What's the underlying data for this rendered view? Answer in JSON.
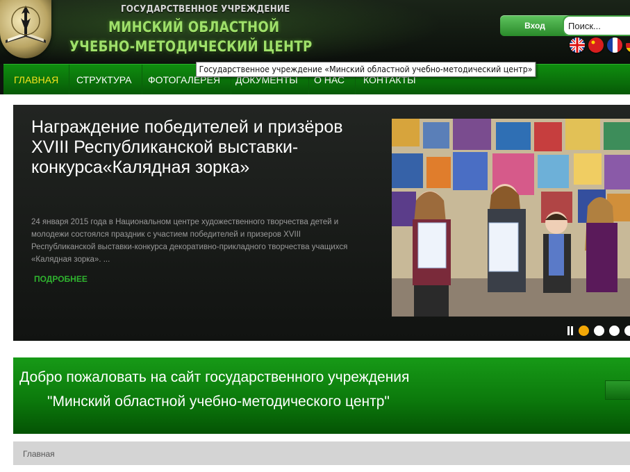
{
  "header": {
    "org_type": "ГОСУДАРСТВЕННОЕ УЧРЕЖДЕНИЕ",
    "org_name_line1": "МИНСКИЙ ОБЛАСТНОЙ",
    "org_name_line2": "УЧЕБНО-МЕТОДИЧЕСКИЙ ЦЕНТР",
    "login_label": "Вход",
    "search_placeholder": "Поиск...",
    "languages": [
      "english-flag-icon",
      "chinese-flag-icon",
      "french-flag-icon",
      "german-flag-icon"
    ]
  },
  "nav": {
    "items": [
      "ГЛАВНАЯ",
      "СТРУКТУРА",
      "ФОТОГАЛЕРЕЯ",
      "ДОКУМЕНТЫ",
      "О НАС",
      "КОНТАКТЫ"
    ],
    "active_index": 0
  },
  "tooltip": "Государственное учреждение «Минский областной учебно-методический центр»",
  "slider": {
    "title": "Награждение победителей и призёров XVIII Республиканской выставки-конкурса«Калядная зорка»",
    "text": "24 января 2015 года в Национальном центре художественного творчества детей и молодежи состоялся праздник с участием победителей и призеров XVIII Республиканской выставки-конкурса декоративно-прикладного творчества учащихся «Калядная зорка». ...",
    "more_label": "ПОДРОБНЕЕ",
    "slide_count": 4,
    "active_slide": 1
  },
  "welcome": {
    "line1": "Добро пожаловать на сайт государственного учреждения",
    "line2": "\"Минский областной учебно-методического центр\""
  },
  "breadcrumb": {
    "current": "Главная"
  },
  "colors": {
    "nav_green": "#0a7a0a",
    "active_nav": "#f7e31c",
    "accent_orange": "#f4a806",
    "more_link": "#2fb32f"
  }
}
